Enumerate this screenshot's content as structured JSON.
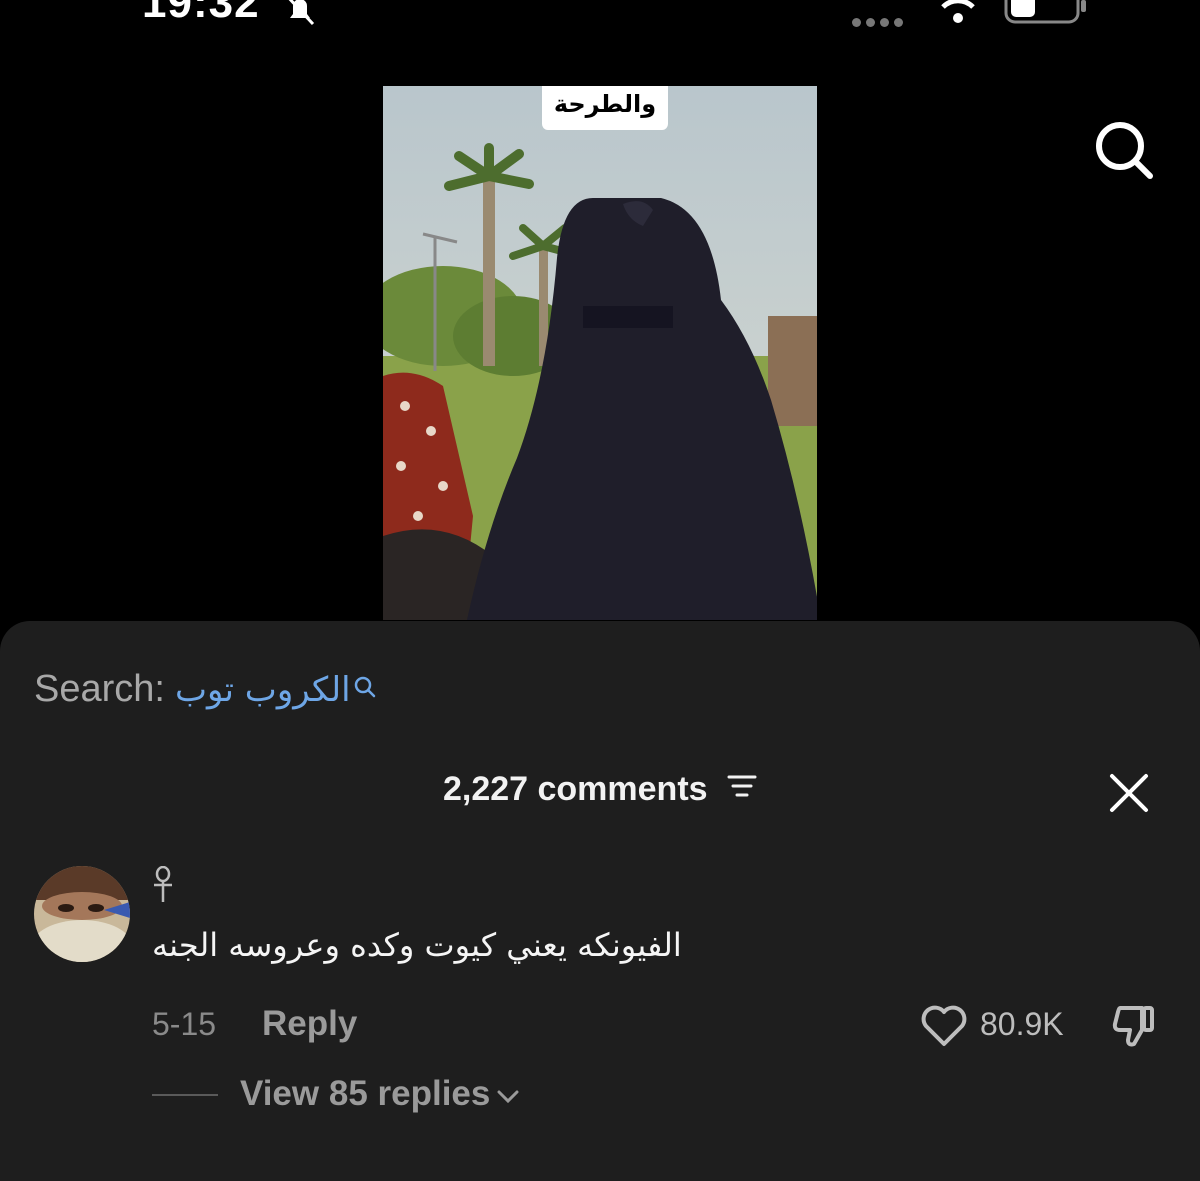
{
  "status_bar": {
    "time": "19:32",
    "icons": [
      "bell-muted-icon",
      "signal-dots-icon",
      "wifi-icon",
      "battery-icon"
    ]
  },
  "video": {
    "caption_overlay": "والطرحة"
  },
  "search": {
    "label": "Search:",
    "term": "الكروب توب",
    "icon": "search-icon"
  },
  "comments": {
    "title": "2,227 comments",
    "items": [
      {
        "username": "☥",
        "text": "الفيونكه يعني كيوت وكده وعروسه الجنه",
        "date": "5-15",
        "reply_label": "Reply",
        "likes": "80.9K",
        "view_replies_label": "View 85 replies"
      }
    ]
  },
  "colors": {
    "background": "#000000",
    "sheet": "#1e1e1e",
    "link_blue": "#6ea6e6",
    "muted_text": "#9a9a9a"
  }
}
